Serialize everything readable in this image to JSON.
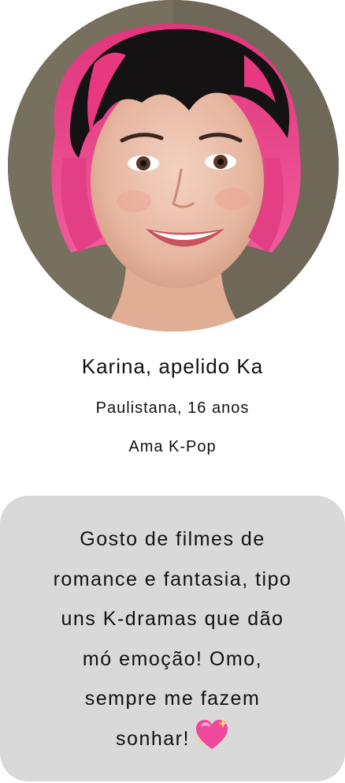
{
  "profile": {
    "name": "Karina, apelido Ka",
    "origin": "Paulistana, 16 anos",
    "likes": "Ama K-Pop"
  },
  "bubble": {
    "line1": "Gosto de filmes de",
    "line2": "romance e fantasia, tipo",
    "line3": "uns K-dramas que dão",
    "line4": "mó emoção! Omo,",
    "line5": "sempre me fazem",
    "line6": "sonhar!"
  },
  "icons": {
    "avatar": "avatar-portrait",
    "emoji": "sparkling-heart-icon"
  },
  "colors": {
    "background": "#ffffff",
    "bubble": "#d9d9d9",
    "text": "#111111",
    "hair_pink": "#e8387f",
    "heart": "#f0489a"
  }
}
